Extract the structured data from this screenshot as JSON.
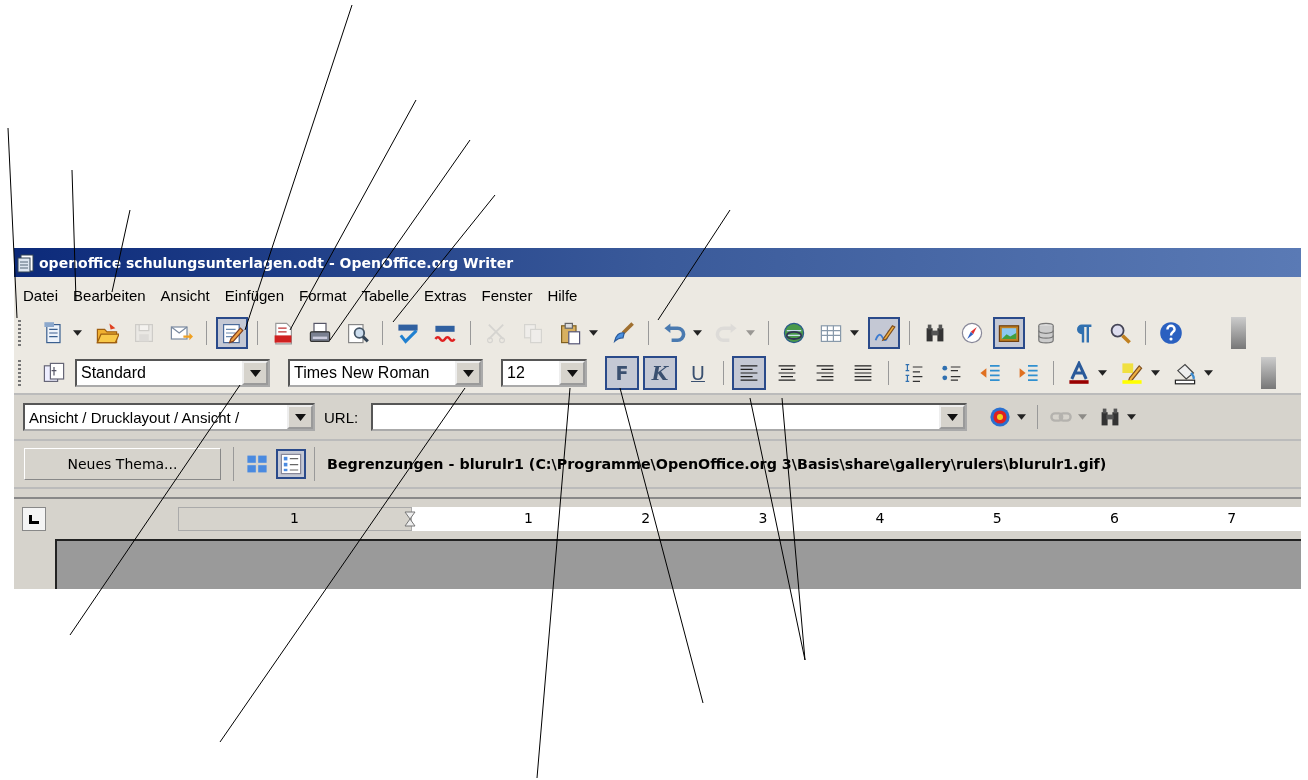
{
  "window": {
    "title": "openoffice schulungsunterlagen.odt - OpenOffice.org Writer"
  },
  "menu": [
    {
      "label": "Datei"
    },
    {
      "label": "Bearbeiten"
    },
    {
      "label": "Ansicht"
    },
    {
      "label": "Einfügen"
    },
    {
      "label": "Format"
    },
    {
      "label": "Tabelle"
    },
    {
      "label": "Extras"
    },
    {
      "label": "Fenster"
    },
    {
      "label": "Hilfe"
    }
  ],
  "standard_toolbar": [
    {
      "kind": "new",
      "dropdown": true,
      "selected": false,
      "disabled": false
    },
    {
      "kind": "open",
      "selected": false,
      "disabled": false
    },
    {
      "kind": "save",
      "selected": false,
      "disabled": true
    },
    {
      "kind": "email",
      "selected": false,
      "disabled": false
    },
    {
      "kind": "separator"
    },
    {
      "kind": "edit",
      "selected": true,
      "disabled": false
    },
    {
      "kind": "separator"
    },
    {
      "kind": "pdf",
      "selected": false,
      "disabled": false
    },
    {
      "kind": "print",
      "selected": false,
      "disabled": false
    },
    {
      "kind": "preview",
      "selected": false,
      "disabled": false
    },
    {
      "kind": "separator"
    },
    {
      "kind": "spellcheck",
      "selected": false,
      "disabled": false
    },
    {
      "kind": "autospell",
      "selected": false,
      "disabled": false
    },
    {
      "kind": "separator"
    },
    {
      "kind": "cut",
      "selected": false,
      "disabled": true
    },
    {
      "kind": "copy",
      "selected": false,
      "disabled": true
    },
    {
      "kind": "paste",
      "dropdown": true,
      "selected": false,
      "disabled": false
    },
    {
      "kind": "brush",
      "selected": false,
      "disabled": false
    },
    {
      "kind": "separator"
    },
    {
      "kind": "undo",
      "dropdown": true,
      "selected": false,
      "disabled": false
    },
    {
      "kind": "redo",
      "dropdown": true,
      "selected": false,
      "disabled": true
    },
    {
      "kind": "separator"
    },
    {
      "kind": "globe",
      "selected": false,
      "disabled": false
    },
    {
      "kind": "table",
      "dropdown": true,
      "selected": false,
      "disabled": false
    },
    {
      "kind": "draw",
      "selected": true,
      "disabled": false
    },
    {
      "kind": "separator"
    },
    {
      "kind": "binoculars",
      "selected": false,
      "disabled": false
    },
    {
      "kind": "compass",
      "selected": false,
      "disabled": false
    },
    {
      "kind": "gallery",
      "selected": true,
      "disabled": false
    },
    {
      "kind": "database",
      "selected": false,
      "disabled": false
    },
    {
      "kind": "pilcrow",
      "selected": false,
      "disabled": false
    },
    {
      "kind": "zoom",
      "selected": false,
      "disabled": false
    },
    {
      "kind": "separator"
    },
    {
      "kind": "help",
      "selected": false,
      "disabled": false
    }
  ],
  "formatting_toolbar": [
    {
      "kind": "styles",
      "selected": false
    },
    {
      "kind": "style-combo",
      "value": "Standard"
    },
    {
      "kind": "font-combo",
      "value": "Times New Roman"
    },
    {
      "kind": "size-combo",
      "value": "12"
    },
    {
      "kind": "bold",
      "label": "F",
      "selected": true
    },
    {
      "kind": "italic",
      "label": "K",
      "selected": true
    },
    {
      "kind": "underline",
      "label": "U",
      "selected": false
    },
    {
      "kind": "separator"
    },
    {
      "kind": "align-left",
      "selected": true
    },
    {
      "kind": "align-center",
      "selected": false
    },
    {
      "kind": "align-right",
      "selected": false
    },
    {
      "kind": "justify",
      "selected": false
    },
    {
      "kind": "separator"
    },
    {
      "kind": "numbering",
      "selected": false
    },
    {
      "kind": "bullets",
      "selected": false
    },
    {
      "kind": "outdent",
      "selected": false
    },
    {
      "kind": "indent",
      "selected": false
    },
    {
      "kind": "separator"
    },
    {
      "kind": "font-color",
      "dropdown": true,
      "selected": false
    },
    {
      "kind": "highlight",
      "dropdown": true,
      "selected": false
    },
    {
      "kind": "fill",
      "dropdown": true,
      "selected": false
    }
  ],
  "hyperlink_bar": {
    "view_combo": {
      "value": "Ansicht / Drucklayout / Ansicht  /"
    },
    "url_label": "URL:",
    "tools": [
      {
        "kind": "target",
        "dropdown": true,
        "disabled": false
      },
      {
        "kind": "separator"
      },
      {
        "kind": "link",
        "dropdown": true,
        "disabled": true
      },
      {
        "kind": "binoculars",
        "dropdown": true,
        "disabled": false
      }
    ]
  },
  "gallery_bar": {
    "new_theme_button": "Neues Thema...",
    "views": [
      {
        "kind": "icons",
        "selected": false
      },
      {
        "kind": "details",
        "selected": true
      }
    ],
    "item_path": "Begrenzungen - blurulr1 (C:\\Programme\\OpenOffice.org 3\\Basis\\share\\gallery\\rulers\\blurulr1.gif)"
  },
  "ruler": {
    "labels": [
      "1",
      "1",
      "2",
      "3",
      "4",
      "5",
      "6",
      "7"
    ]
  }
}
